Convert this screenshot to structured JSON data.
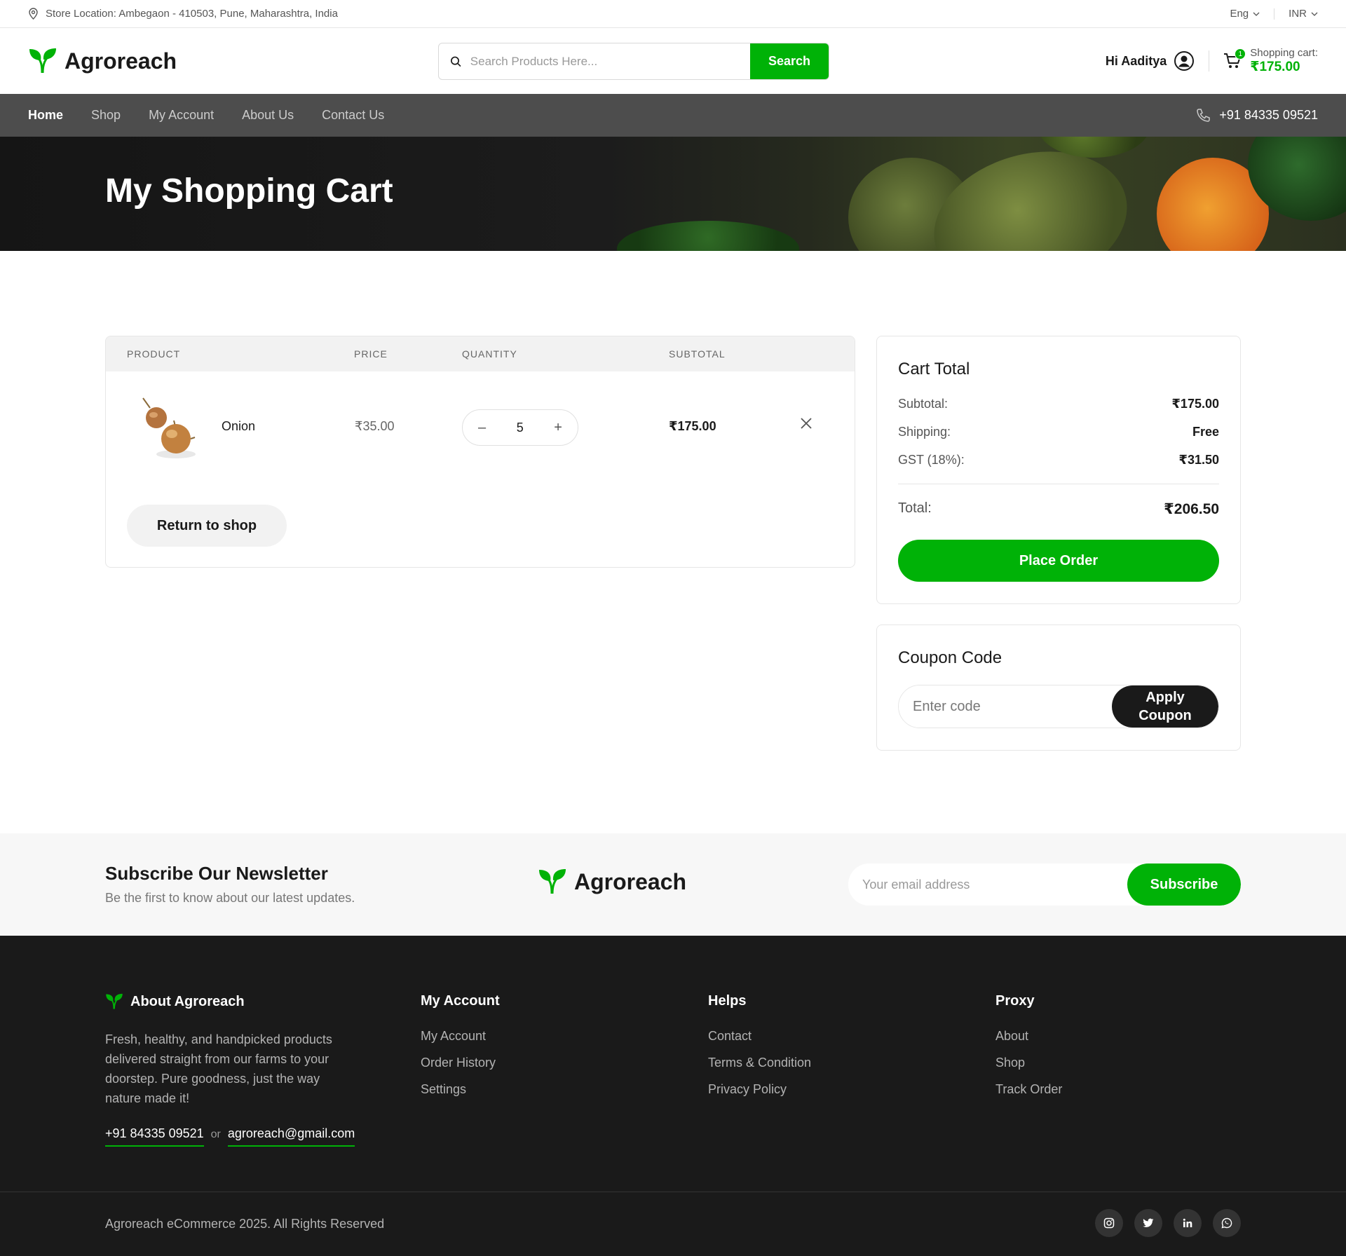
{
  "topbar": {
    "location": "Store Location: Ambegaon - 410503, Pune, Maharashtra, India",
    "language": "Eng",
    "currency": "INR"
  },
  "header": {
    "logo_text": "Agroreach",
    "search_placeholder": "Search Products Here...",
    "search_button": "Search",
    "greeting": "Hi Aaditya",
    "cart_label": "Shopping cart:",
    "cart_amount": "₹175.00",
    "cart_count": "1"
  },
  "nav": {
    "items": [
      "Home",
      "Shop",
      "My Account",
      "About Us",
      "Contact Us"
    ],
    "phone": "+91 84335 09521"
  },
  "banner": {
    "title": "My Shopping Cart"
  },
  "cart_table": {
    "headers": [
      "PRODUCT",
      "PRICE",
      "QUANTITY",
      "SUBTOTAL"
    ],
    "items": [
      {
        "name": "Onion",
        "price": "₹35.00",
        "quantity": "5",
        "subtotal": "₹175.00"
      }
    ],
    "qty_minus": "–",
    "qty_plus": "+",
    "return_button": "Return to shop"
  },
  "cart_total": {
    "title": "Cart Total",
    "subtotal_label": "Subtotal:",
    "subtotal_value": "₹175.00",
    "shipping_label": "Shipping:",
    "shipping_value": "Free",
    "gst_label": "GST (18%):",
    "gst_value": "₹31.50",
    "total_label": "Total:",
    "total_value": "₹206.50",
    "place_order": "Place Order"
  },
  "coupon": {
    "title": "Coupon Code",
    "placeholder": "Enter code",
    "button": "Apply Coupon"
  },
  "newsletter": {
    "title": "Subscribe Our Newsletter",
    "subtitle": "Be the first to know about our latest updates.",
    "logo_text": "Agroreach",
    "placeholder": "Your email address",
    "button": "Subscribe"
  },
  "footer": {
    "about_title": "About Agroreach",
    "about_text": "Fresh, healthy, and handpicked products delivered straight from our farms to your doorstep. Pure goodness, just the way nature made it!",
    "phone": "+91 84335 09521",
    "or": "or",
    "email": "agroreach@gmail.com",
    "columns": [
      {
        "title": "My Account",
        "links": [
          "My Account",
          "Order History",
          "Settings"
        ]
      },
      {
        "title": "Helps",
        "links": [
          "Contact",
          "Terms & Condition",
          "Privacy Policy"
        ]
      },
      {
        "title": "Proxy",
        "links": [
          "About",
          "Shop",
          "Track Order"
        ]
      }
    ],
    "copyright": "Agroreach eCommerce 2025. All Rights Reserved",
    "socials": [
      "instagram-icon",
      "twitter-icon",
      "linkedin-icon",
      "whatsapp-icon"
    ]
  },
  "colors": {
    "accent": "#00b207",
    "dark": "#1a1a1a",
    "nav_bg": "#4d4d4d"
  }
}
